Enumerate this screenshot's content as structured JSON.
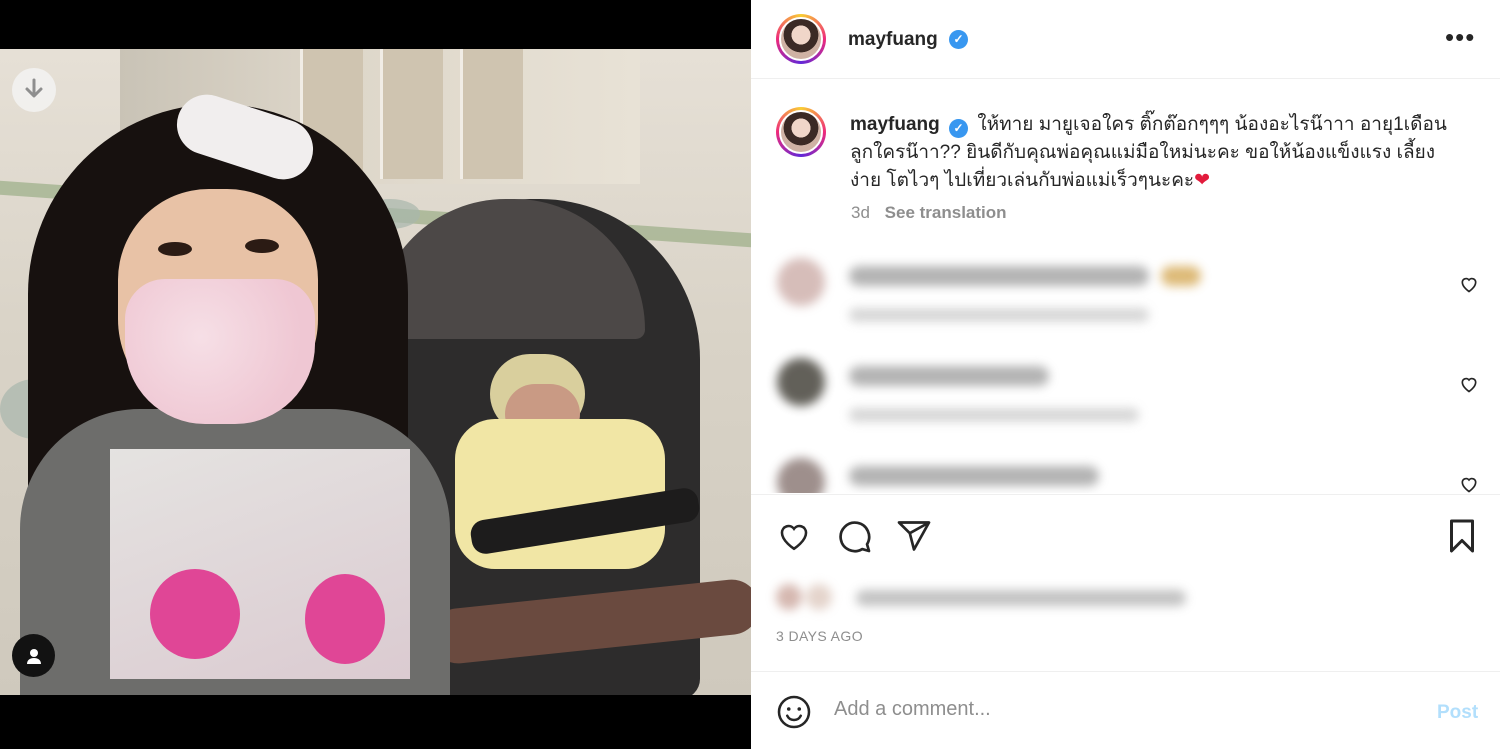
{
  "post": {
    "username": "mayfuang",
    "verified": true,
    "caption": "ให้ทาย มายูเจอใคร ติ๊กต๊อกๆๆๆ น้องอะไรน๊าาา อายุ1เดือน ลูกใครน๊าา?? ยินดีกับคุณพ่อคุณแม่มือใหม่นะคะ ขอให้น้องแข็งแรง เลี้ยงง่าย โตไวๆ ไปเที่ยวเล่นกับพ่อแม่เร็วๆนะคะ",
    "caption_emoji": "❤",
    "age": "3d",
    "see_translation": "See translation",
    "date": "3 DAYS AGO"
  },
  "icons": {
    "more": "more-options-icon",
    "download": "download-icon",
    "tag": "user-tag-icon",
    "like": "heart-icon",
    "comment": "comment-icon",
    "share": "share-icon",
    "save": "bookmark-icon",
    "emoji": "emoji-icon"
  },
  "comment_box": {
    "placeholder": "Add a comment...",
    "post_label": "Post"
  },
  "colors": {
    "verified": "#3897f0",
    "post_disabled": "#b2dffc",
    "muted_text": "#8e8e8e"
  }
}
